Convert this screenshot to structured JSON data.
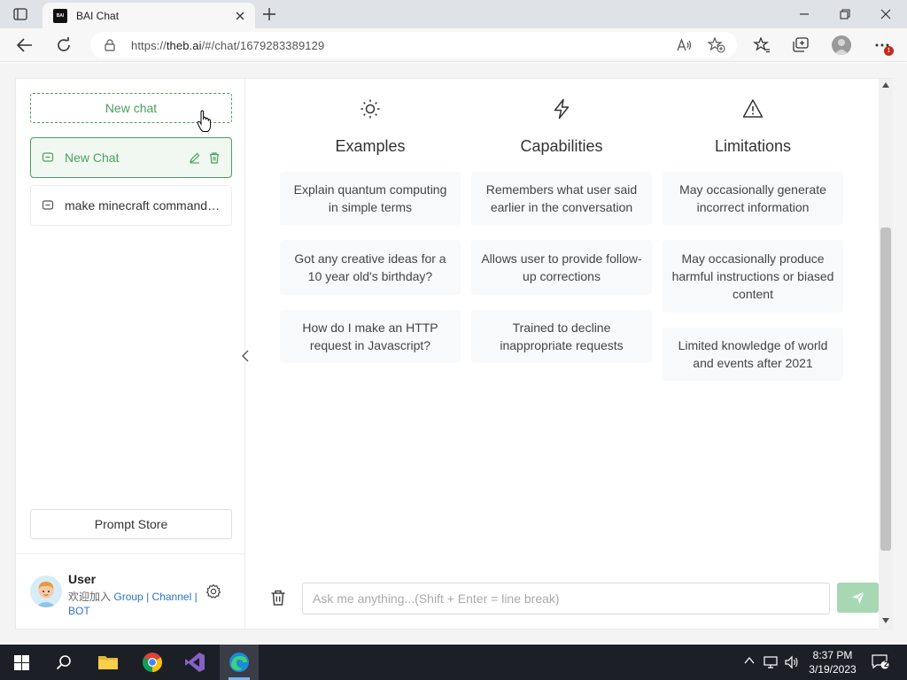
{
  "browser": {
    "tab_title": "BAI Chat",
    "favicon_text": "BAI",
    "url_prefix": "https://",
    "url_host": "theb.ai",
    "url_path": "/#/chat/1679283389129",
    "notification_badge": "1"
  },
  "sidebar": {
    "new_chat_label": "New chat",
    "chats": [
      {
        "label": "New Chat",
        "active": true
      },
      {
        "label": "make minecraft command ...",
        "active": false
      }
    ],
    "prompt_store_label": "Prompt Store",
    "user": {
      "name": "User",
      "join_text": "欢迎加入",
      "group": "Group",
      "channel": "Channel",
      "bot": "BOT",
      "separator": "|"
    }
  },
  "main": {
    "columns": [
      {
        "icon": "sun-icon",
        "title": "Examples",
        "cards": [
          "Explain quantum computing in simple terms",
          "Got any creative ideas for a 10 year old's birthday?",
          "How do I make an HTTP request in Javascript?"
        ]
      },
      {
        "icon": "lightning-icon",
        "title": "Capabilities",
        "cards": [
          "Remembers what user said earlier in the conversation",
          "Allows user to provide follow-up corrections",
          "Trained to decline inappropriate requests"
        ]
      },
      {
        "icon": "warning-triangle-icon",
        "title": "Limitations",
        "cards": [
          "May occasionally generate incorrect information",
          "May occasionally produce harmful instructions or biased content",
          "Limited knowledge of world and events after 2021"
        ]
      }
    ],
    "composer": {
      "placeholder": "Ask me anything...(Shift + Enter = line break)",
      "value": ""
    }
  },
  "taskbar": {
    "time": "8:37 PM",
    "date": "3/19/2023",
    "notification_count": "2"
  },
  "colors": {
    "accent": "#4b9e5f",
    "send_button": "#a7d8b3",
    "card_bg": "#f7f9fb"
  }
}
